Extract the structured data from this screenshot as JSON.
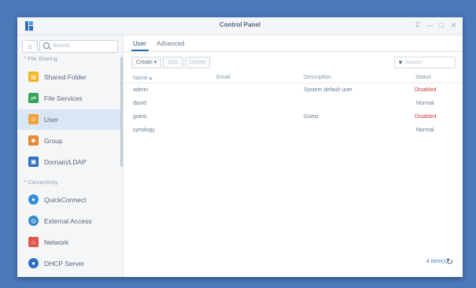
{
  "window": {
    "title": "Control Panel"
  },
  "titlebar": {
    "pin_icon": "pin-icon",
    "minimize_icon": "minimize-icon",
    "maximize_icon": "maximize-icon",
    "close_icon": "close-icon"
  },
  "sidebar": {
    "search_placeholder": "Search",
    "sections": [
      "File Sharing",
      "Connectivity"
    ],
    "items": [
      {
        "label": "Shared Folder",
        "icon": "shared-folder-icon",
        "color": "#f5b31b"
      },
      {
        "label": "File Services",
        "icon": "file-services-icon",
        "color": "#3aa35a"
      },
      {
        "label": "User",
        "icon": "user-icon",
        "color": "#f0a23a"
      },
      {
        "label": "Group",
        "icon": "group-icon",
        "color": "#e58b3a"
      },
      {
        "label": "Domain/LDAP",
        "icon": "domain-ldap-icon",
        "color": "#2e6fc0"
      },
      {
        "label": "QuickConnect",
        "icon": "quickconnect-icon",
        "color": "#2f8fd8"
      },
      {
        "label": "External Access",
        "icon": "external-access-icon",
        "color": "#2f86c9"
      },
      {
        "label": "Network",
        "icon": "network-icon",
        "color": "#e0574a"
      },
      {
        "label": "DHCP Server",
        "icon": "dhcp-server-icon",
        "color": "#2e6fc0"
      }
    ]
  },
  "tabs": [
    "User",
    "Advanced"
  ],
  "toolbar": {
    "create": "Create",
    "edit": "Edit",
    "delete": "Delete",
    "filter_placeholder": "Search"
  },
  "table": {
    "columns": [
      "Name ▴",
      "Email",
      "Description",
      "Status"
    ],
    "rows": [
      {
        "name": "admin",
        "email": "",
        "description": "System default user",
        "status": "Disabled"
      },
      {
        "name": "david",
        "email": "",
        "description": "",
        "status": "Normal"
      },
      {
        "name": "guest",
        "email": "",
        "description": "Guest",
        "status": "Disabled"
      },
      {
        "name": "synology",
        "email": "",
        "description": "",
        "status": "Normal"
      }
    ]
  },
  "footer": {
    "count": "4 item(s)"
  }
}
